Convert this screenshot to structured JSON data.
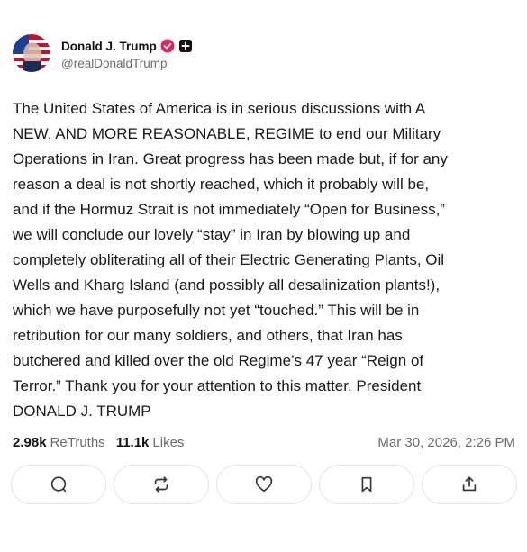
{
  "author": {
    "display_name": "Donald J. Trump",
    "handle": "@realDonaldTrump",
    "verified_color": "#e0245e"
  },
  "post": {
    "text": "The United States of America is in serious discussions with A\nNEW, AND MORE REASONABLE, REGIME to end our Military\nOperations in Iran. Great progress has been made but, if for any\nreason a deal is not shortly reached, which it probably will be,\nand if the Hormuz Strait is not immediately “Open for Business,”\nwe will conclude our lovely “stay” in Iran by blowing up and\ncompletely obliterating all of their Electric Generating Plants, Oil\nWells and Kharg Island (and possibly all desalinization plants!),\nwhich we have purposefully not yet “touched.” This will be in\nretribution for our many soldiers, and others, that Iran has\nbutchered and killed over the old Regime’s 47 year “Reign of\nTerror.” Thank you for your attention to this matter. President\nDONALD J. TRUMP"
  },
  "stats": {
    "retruths_count": "2.98k",
    "retruths_label": "ReTruths",
    "likes_count": "11.1k",
    "likes_label": "Likes",
    "timestamp": "Mar 30, 2026, 2:26 PM"
  },
  "actions": [
    {
      "icon": "reply-icon"
    },
    {
      "icon": "retruth-icon"
    },
    {
      "icon": "heart-icon"
    },
    {
      "icon": "bookmark-icon"
    },
    {
      "icon": "share-icon"
    }
  ]
}
